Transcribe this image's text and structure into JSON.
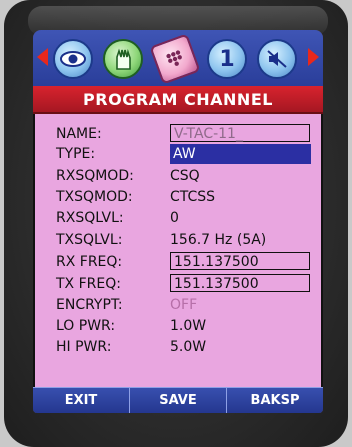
{
  "header": {
    "title": "PROGRAM CHANNEL"
  },
  "toolbar": {
    "tabs": [
      {
        "icon": "eye-icon"
      },
      {
        "icon": "hand-icon"
      },
      {
        "icon": "keypad-icon",
        "selected": true
      },
      {
        "icon": "number-one-icon",
        "label": "1"
      },
      {
        "icon": "speaker-mute-icon"
      }
    ]
  },
  "fields": {
    "name": {
      "label": "NAME:",
      "value": "V-TAC-11_"
    },
    "type": {
      "label": "TYPE:",
      "value": "AW"
    },
    "rxsqmod": {
      "label": "RXSQMOD:",
      "value": "CSQ"
    },
    "txsqmod": {
      "label": "TXSQMOD:",
      "value": "CTCSS"
    },
    "rxsqlvl": {
      "label": "RXSQLVL:",
      "value": "0"
    },
    "txsqlvl": {
      "label": "TXSQLVL:",
      "value": "156.7 Hz (5A)"
    },
    "rxfreq": {
      "label": "RX FREQ:",
      "value": "151.137500"
    },
    "txfreq": {
      "label": "TX FREQ:",
      "value": "151.137500"
    },
    "encrypt": {
      "label": "ENCRYPT:",
      "value": "OFF"
    },
    "lopwr": {
      "label": "LO PWR:",
      "value": "1.0W"
    },
    "hipwr": {
      "label": "HI PWR:",
      "value": "5.0W"
    }
  },
  "softkeys": {
    "exit": "EXIT",
    "save": "SAVE",
    "baksp": "BAKSP"
  },
  "colors": {
    "screen_bg": "#e9a6e0",
    "header_bg": "#d8232e",
    "selection_bg": "#2b2fa3",
    "toolbar_bg": "#3f55b5"
  }
}
